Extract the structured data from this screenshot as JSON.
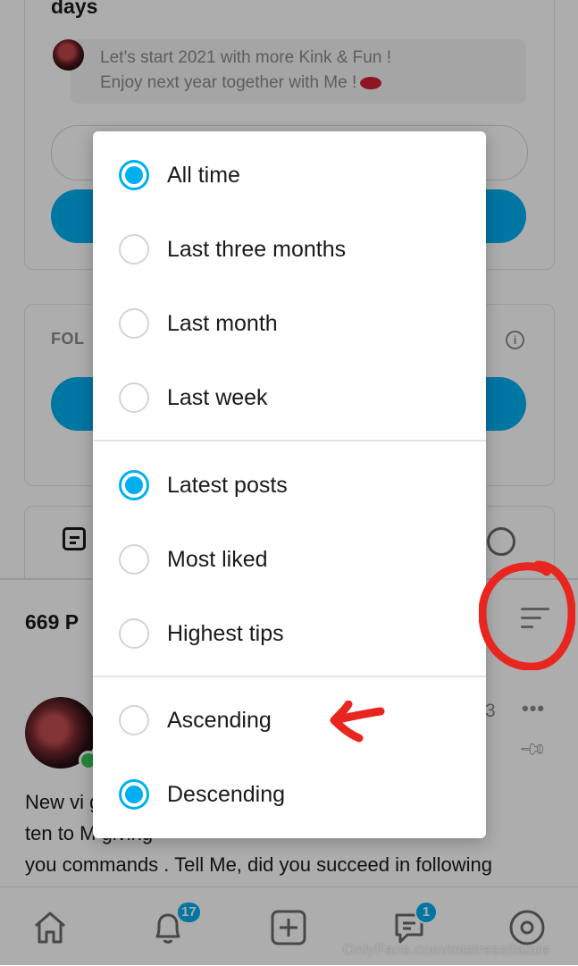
{
  "background": {
    "heading_fragment": "days",
    "message_preview": "Let’s start 2021 with more Kink & Fun !\nEnjoy next year together with Me !",
    "followers_label_fragment": "FOL",
    "info_icon": "info-icon",
    "posts_count_fragment": "669 P",
    "post_meta_fragment": "3",
    "more_label": "•••",
    "post_text": "New vi                                              g - Lis-\nten to M                                                giving\nyou commands . Tell Me, did you succeed in following",
    "nav": {
      "notifications_badge": "17",
      "messages_badge": "1"
    },
    "watermark": "OnlyFans.com/mistressifatale"
  },
  "sort_menu": {
    "period_options": [
      {
        "label": "All time",
        "selected": true
      },
      {
        "label": "Last three months",
        "selected": false
      },
      {
        "label": "Last month",
        "selected": false
      },
      {
        "label": "Last week",
        "selected": false
      }
    ],
    "sort_by_options": [
      {
        "label": "Latest posts",
        "selected": true
      },
      {
        "label": "Most liked",
        "selected": false
      },
      {
        "label": "Highest tips",
        "selected": false
      }
    ],
    "order_options": [
      {
        "label": "Ascending",
        "selected": false
      },
      {
        "label": "Descending",
        "selected": true
      }
    ]
  },
  "colors": {
    "accent": "#00aff0",
    "annotation_red": "#e8261f",
    "overlay": "rgba(0,0,0,0.32)"
  }
}
